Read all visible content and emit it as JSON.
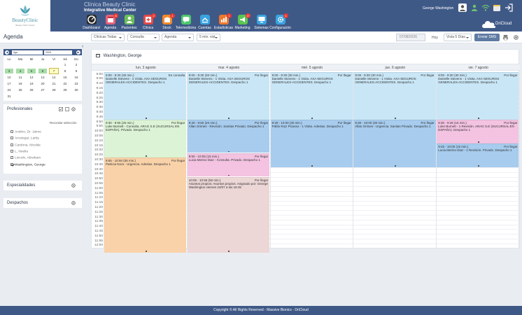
{
  "brand": {
    "name": "BeautyClinic",
    "tagline": "Beauty Clinic Center"
  },
  "header": {
    "clinic_name": "Clínica Beauty Clinic",
    "center_name": "Integrative Medical Center",
    "user_name": "George Washington",
    "cloud_label": "DriCloud"
  },
  "nav": [
    {
      "label": "Dashboard",
      "icon": "dashboard-icon",
      "color": "#2b2b2b",
      "badge": ""
    },
    {
      "label": "Agenda",
      "icon": "agenda-icon",
      "color": "#e8607a",
      "badge": "8"
    },
    {
      "label": "Pacientes",
      "icon": "patients-icon",
      "color": "#6bbf59",
      "badge": ""
    },
    {
      "label": "Clínica",
      "icon": "clinic-icon",
      "color": "#e34b4b",
      "badge": "2"
    },
    {
      "label": "Stock",
      "icon": "stock-icon",
      "color": "#f08a2c",
      "badge": "1"
    },
    {
      "label": "Telemedicina",
      "icon": "telemedicine-icon",
      "color": "#4cc76b",
      "badge": ""
    },
    {
      "label": "Cuentas",
      "icon": "accounts-icon",
      "color": "#3aa3e0",
      "badge": ""
    },
    {
      "label": "Estadísticas",
      "icon": "statistics-icon",
      "color": "#f0792c",
      "badge": "1"
    },
    {
      "label": "Marketing",
      "icon": "marketing-icon",
      "color": "#5bc452",
      "badge": "17"
    },
    {
      "label": "Sistemas",
      "icon": "systems-icon",
      "color": "#3aa3e0",
      "badge": ""
    },
    {
      "label": "Configuración",
      "icon": "settings-icon",
      "color": "#3aa3e0",
      "badge": "1"
    }
  ],
  "toolbar": {
    "title": "Agenda",
    "clinic_filter": "Clínicas Todas",
    "type_filter": "Consulta",
    "view_filter": "Agenda",
    "interval": "5 min. vist",
    "date_value": "07/08/2026",
    "today_label": "Hoy",
    "days_view": "Vista 5 Días",
    "sms_button": "Enviar SMS"
  },
  "mini_calendar": {
    "month": "Ago",
    "year": "2026",
    "dow": [
      "Lu",
      "Ma",
      "Mi",
      "Ju",
      "Vi",
      "Sá",
      "Do"
    ],
    "rows": [
      [
        "",
        "",
        "",
        "",
        "",
        "1",
        "2"
      ],
      [
        "3",
        "4",
        "5",
        "6",
        "7",
        "8",
        "9"
      ],
      [
        "10",
        "11",
        "12",
        "13",
        "14",
        "15",
        "16"
      ],
      [
        "17",
        "18",
        "19",
        "20",
        "21",
        "22",
        "23"
      ],
      [
        "24",
        "25",
        "26",
        "27",
        "28",
        "29",
        "30"
      ],
      [
        "31",
        "",
        "",
        "",
        "",
        "",
        ""
      ]
    ],
    "highlight_week": 1,
    "today": "7"
  },
  "profesionales": {
    "title": "Profesionales",
    "reset_label": "Recordar selección",
    "items": [
      {
        "name": "Andino, Dr. Jaime",
        "checked": false
      },
      {
        "name": "Arcetegui, Larby",
        "checked": false
      },
      {
        "name": "Cardona, Nicolás",
        "checked": false
      },
      {
        "name": "L, Noelia",
        "checked": false
      },
      {
        "name": "Lincoln, Abraham",
        "checked": false
      },
      {
        "name": "Washington, George",
        "checked": true
      }
    ]
  },
  "especialidades": {
    "title": "Especialidades"
  },
  "despachos": {
    "title": "Despachos"
  },
  "schedule": {
    "professional": "Washington, George",
    "days": [
      "lun. 3 agosto",
      "mar. 4 agosto",
      "mié. 5 agosto",
      "jue. 6 agosto",
      "vie. 7 agosto"
    ],
    "times": [
      "9:00",
      "9:05",
      "9:10",
      "9:15",
      "9:20",
      "9:25",
      "9:30",
      "9:35",
      "9:40",
      "9:45",
      "9:50",
      "9:55",
      "10:00",
      "10:05",
      "10:10",
      "10:15",
      "10:20",
      "10:25",
      "10:30",
      "10:35",
      "10:40",
      "10:45",
      "10:50",
      "10:55",
      "11:00",
      "11:05",
      "11:10",
      "11:15",
      "11:20",
      "11:25",
      "11:30",
      "11:35",
      "11:40",
      "11:45",
      "11:50",
      "11:55",
      "12:00"
    ],
    "events": [
      {
        "day": 0,
        "start": 0,
        "slots": 10,
        "color": "#c9e6f6",
        "time": "9:00 - 9:30 (30 min.)",
        "status": "En consulta",
        "desc": "Danielle Stevens - 1 Visita. AXA SEGUROS GENERALES-ACCIDENTES. Despacho 1"
      },
      {
        "day": 0,
        "start": 10,
        "slots": 8,
        "color": "#dcf3d6",
        "time": "9:30 - 9:55 (25 min.)",
        "status": "Por llegar",
        "desc": "Luke Burnett - Consulta. ARAG S.E (SUCURSAL EN ESPAÑA). Privado. Despacho 1"
      },
      {
        "day": 0,
        "start": 18,
        "slots": 20,
        "color": "#f9d2a9",
        "time": "9:55 - 10:50 (55 min.)",
        "status": "Por llegar",
        "desc": "Patricia Nora - Urgencia. Adeslas. Despacho 1"
      },
      {
        "day": 1,
        "start": 0,
        "slots": 10,
        "color": "#c9e6f6",
        "time": "9:00 - 9:30 (30 min.)",
        "status": "Por llegar",
        "desc": "Danielle Stevens - 1 Visita. AXA SEGUROS GENERALES-ACCIDENTES. Despacho 1"
      },
      {
        "day": 1,
        "start": 10,
        "slots": 7,
        "color": "#a7ccee",
        "time": "9:30 - 9:50 (20 min.)",
        "status": "Por llegar",
        "desc": "Allan Grimes - Revisión. Sanitas Privado. Despacho 1"
      },
      {
        "day": 1,
        "start": 17,
        "slots": 5,
        "color": "#f3c3e1",
        "time": "9:50 - 10:05 (15 min.)",
        "status": "Por llegar",
        "desc": "Lucia Merino Diaz - Consulta. Privado. Despacho 1"
      },
      {
        "day": 1,
        "start": 22,
        "slots": 16,
        "color": "#ecd6d6",
        "time": "10:05 - 10:55 (50 min.)",
        "status": "Por llegar",
        "desc": "Asuntos propios: Asuntos propios. Asignado por: George Washington viernes 24/07 a las 16:45"
      },
      {
        "day": 2,
        "start": 0,
        "slots": 10,
        "color": "#c9e6f6",
        "time": "9:00 - 9:30 (30 min.)",
        "status": "Por llegar",
        "desc": "Danielle Stevens - 1 Visita. AXA SEGUROS GENERALES-ACCIDENTES. Despacho 1"
      },
      {
        "day": 2,
        "start": 10,
        "slots": 10,
        "color": "#a7ccee",
        "time": "9:30 - 10:00 (30 min.)",
        "status": "Por llegar",
        "desc": "Pablo Ruiz Picasso - 1 Visita. Adeslas. Despacho 1"
      },
      {
        "day": 3,
        "start": 0,
        "slots": 10,
        "color": "#c9e6f6",
        "time": "9:00 - 9:30 (30 min.)",
        "status": "Por llegar",
        "desc": "Danielle Stevens - 1 Visita. AXA SEGUROS GENERALES-ACCIDENTES. Despacho 1"
      },
      {
        "day": 3,
        "start": 10,
        "slots": 10,
        "color": "#a7ccee",
        "time": "9:30 - 10:00 (30 min.)",
        "status": "Por llegar",
        "desc": "Allan Grimes - Urgencia. Sanitas Privado. Despacho 1"
      },
      {
        "day": 4,
        "start": 0,
        "slots": 10,
        "color": "#c9e6f6",
        "time": "9:00 - 9:30 (30 min.)",
        "status": "Por llegar",
        "desc": "Danielle Stevens - 1 Visita. AXA SEGUROS GENERALES-ACCIDENTES. Despacho 1"
      },
      {
        "day": 4,
        "start": 10,
        "slots": 5,
        "color": "#f3c3e1",
        "time": "9:30 - 9:45 (15 min.)",
        "status": "Por llegar",
        "desc": "Luke Burnett - 1 Revisión. ARAG S.E (SUCURSAL EN ESPAÑA). Despacho 1"
      },
      {
        "day": 4,
        "start": 15,
        "slots": 5,
        "color": "#a7ccee",
        "time": "9:45 - 10:00 (15 min.)",
        "status": "Por llegar",
        "desc": "Lucia Merino Diaz - 1 Revisión. Privado. Despacho 1"
      }
    ]
  },
  "footer": {
    "text": "Copyright © All Rights Reserved - Massive Bionics - DriCloud"
  }
}
